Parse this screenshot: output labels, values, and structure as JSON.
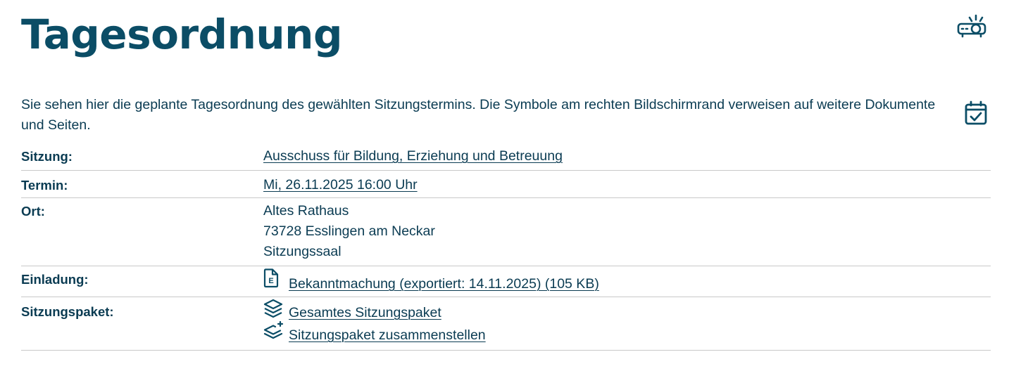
{
  "page": {
    "title": "Tagesordnung",
    "intro": "Sie sehen hier die geplante Tagesordnung des gewählten Sitzungstermins. Die Symbole am rechten Bildschirmrand verweisen auf weitere Dokumente und Seiten."
  },
  "details": {
    "sitzung": {
      "label": "Sitzung:",
      "value": "Ausschuss für Bildung, Erziehung und Betreuung"
    },
    "termin": {
      "label": "Termin:",
      "value": "Mi, 26.11.2025 16:00 Uhr"
    },
    "ort": {
      "label": "Ort:",
      "lines": [
        "Altes Rathaus",
        "73728 Esslingen am Neckar",
        "Sitzungssaal"
      ]
    },
    "einladung": {
      "label": "Einladung:",
      "link": "Bekanntmachung (exportiert: 14.11.2025) (105 KB)",
      "icon_letter": "E"
    },
    "sitzungspaket": {
      "label": "Sitzungspaket:",
      "links": [
        "Gesamtes Sitzungspaket",
        "Sitzungspaket zusammenstellen"
      ]
    }
  },
  "icons": {
    "projector": "projector-icon",
    "calendar": "calendar-check-icon",
    "document": "document-icon",
    "layers": "layers-icon",
    "layers_add": "layers-plus-icon"
  },
  "colors": {
    "primary": "#0b4d66",
    "text": "#0a3b52",
    "divider": "#c9c9c9"
  }
}
